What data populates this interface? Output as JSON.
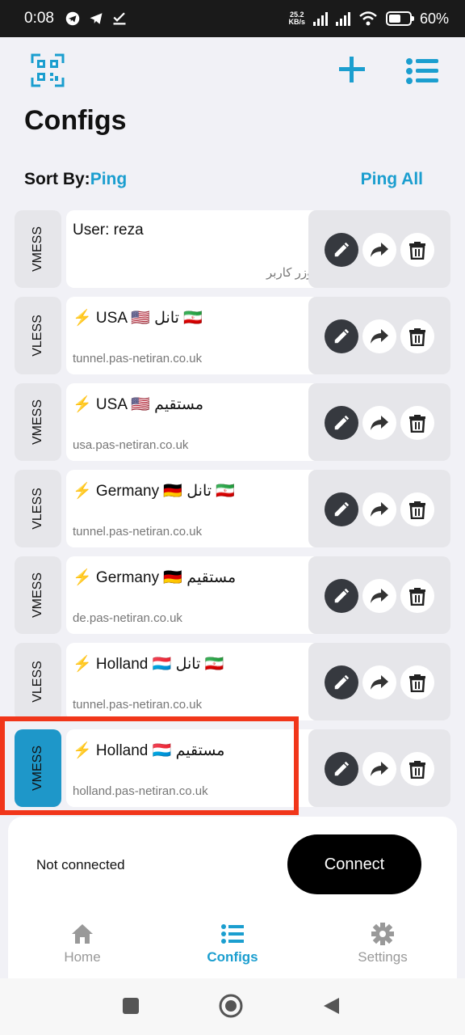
{
  "status_bar": {
    "time": "0:08",
    "speed_value": "25.2",
    "speed_unit": "KB/s",
    "battery_percent": "60%",
    "battery_level": 0.6,
    "left_icons": [
      "telegram-icon",
      "telegram-icon",
      "download-check-icon"
    ],
    "right_icons": [
      "signal-icon",
      "signal-icon",
      "wifi-icon",
      "battery-icon"
    ]
  },
  "header": {
    "title": "Configs",
    "sort_label": "Sort By:",
    "sort_value": "Ping",
    "ping_all": "Ping All",
    "icons": [
      "qr-scan-icon",
      "add-icon",
      "list-icon"
    ]
  },
  "configs": [
    {
      "protocol": "VMESS",
      "name": "User: reza",
      "address": "یوزر کاربر",
      "active": false
    },
    {
      "protocol": "VLESS",
      "name": "⚡ USA 🇺🇸 تانل 🇮🇷",
      "address": "tunnel.pas-netiran.co.uk",
      "active": false
    },
    {
      "protocol": "VMESS",
      "name": "⚡ USA 🇺🇸 مستقیم",
      "address": "usa.pas-netiran.co.uk",
      "active": false
    },
    {
      "protocol": "VLESS",
      "name": "⚡ Germany 🇩🇪 تانل 🇮🇷",
      "address": "tunnel.pas-netiran.co.uk",
      "active": false
    },
    {
      "protocol": "VMESS",
      "name": "⚡ Germany 🇩🇪 مستقیم",
      "address": "de.pas-netiran.co.uk",
      "active": false
    },
    {
      "protocol": "VLESS",
      "name": "⚡ Holland 🇱🇺 تانل 🇮🇷",
      "address": "tunnel.pas-netiran.co.uk",
      "active": false
    },
    {
      "protocol": "VMESS",
      "name": "⚡ Holland 🇱🇺 مستقیم",
      "address": "holland.pas-netiran.co.uk",
      "active": true
    }
  ],
  "connection": {
    "status": "Not connected",
    "button": "Connect"
  },
  "nav": {
    "home": "Home",
    "configs": "Configs",
    "settings": "Settings"
  },
  "colors": {
    "accent": "#1b9ecf",
    "active_protocol": "#1e97c9",
    "highlight": "#f1361a",
    "edit_button": "#36393f"
  }
}
